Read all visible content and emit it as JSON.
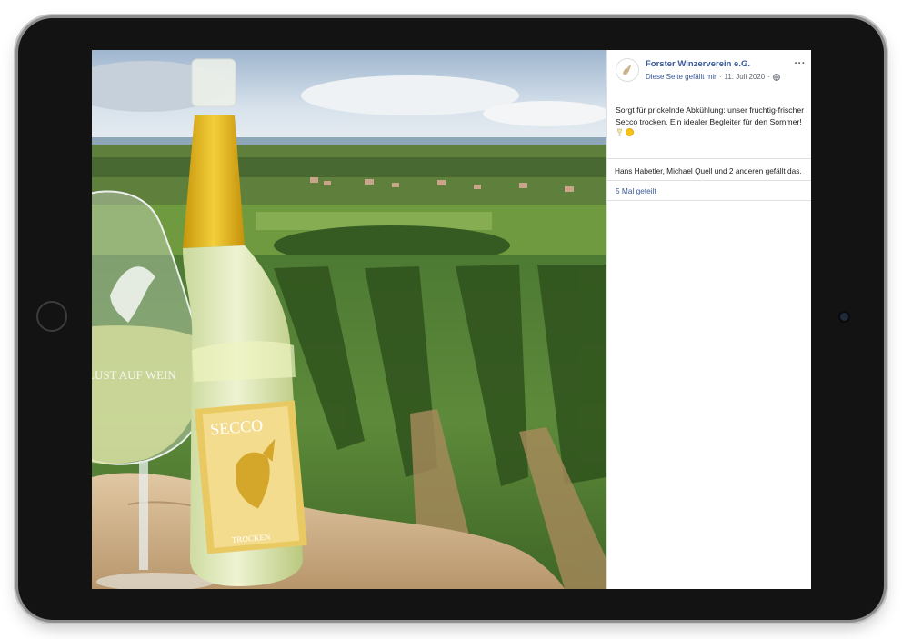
{
  "post": {
    "page_name": "Forster Winzerverein e.G.",
    "liked_text": "Diese Seite gefällt mir",
    "separator": "·",
    "date": "11. Juli 2020",
    "more_label": "···",
    "text": "Sorgt für prickelnde Abkühlung: unser fruchtig-frischer Secco trocken. Ein idealer Begleiter für den Sommer!",
    "likes": "Hans Habetler, Michael Quell und 2 anderen gefällt das.",
    "shares": "5 Mal geteilt"
  },
  "photo": {
    "label_main": "SECCO",
    "label_sub": "TROCKEN",
    "glass_text": "LUST AUF WEIN"
  },
  "colors": {
    "link_blue": "#385898",
    "secondary_gray": "#606770",
    "divider": "#dddfe2",
    "bottle_foil": "#e8bb1c",
    "label_gold": "#e9c962"
  },
  "icons": [
    "globe-icon",
    "more-icon",
    "sparkling-glass-emoji-icon",
    "sun-emoji-icon",
    "griffin-logo-icon"
  ]
}
